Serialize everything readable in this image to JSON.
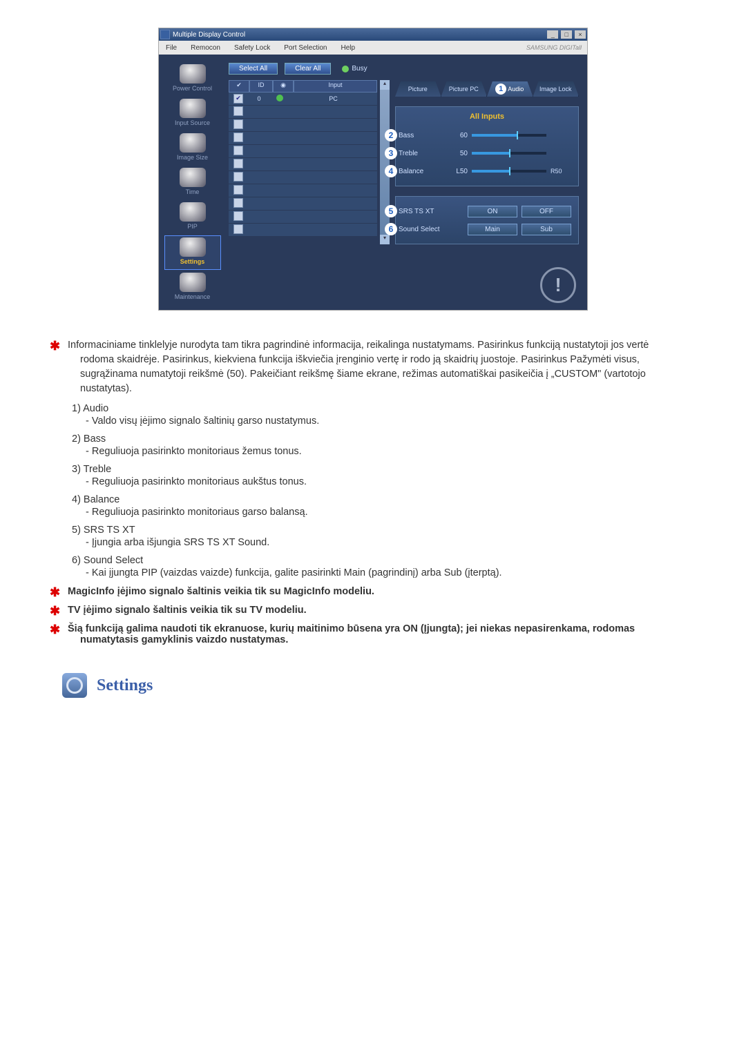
{
  "window": {
    "title": "Multiple Display Control",
    "win_buttons": {
      "min": "_",
      "max": "□",
      "close": "×"
    }
  },
  "menubar": {
    "items": [
      "File",
      "Remocon",
      "Safety Lock",
      "Port Selection",
      "Help"
    ],
    "brand": "SAMSUNG DIGITall"
  },
  "sidebar": {
    "items": [
      {
        "label": "Power Control"
      },
      {
        "label": "Input Source"
      },
      {
        "label": "Image Size"
      },
      {
        "label": "Time"
      },
      {
        "label": "PIP"
      },
      {
        "label": "Settings",
        "active": true
      },
      {
        "label": "Maintenance"
      }
    ]
  },
  "buttons": {
    "select_all": "Select All",
    "clear_all": "Clear All",
    "busy": "Busy"
  },
  "list": {
    "headers": {
      "check": "✔",
      "id": "ID",
      "status": "◉",
      "input": "Input"
    },
    "first_row": {
      "id": "0",
      "input": "PC",
      "checked": true,
      "online": true
    },
    "blank_rows": 10
  },
  "tabs": {
    "picture": "Picture",
    "picture_pc": "Picture PC",
    "audio": "Audio",
    "image_lock": "Image Lock",
    "badge_audio": "1"
  },
  "panel": {
    "all_inputs": "All Inputs",
    "rows": [
      {
        "num": "2",
        "label": "Bass",
        "val": "60",
        "pct": 60,
        "pre": "",
        "post": ""
      },
      {
        "num": "3",
        "label": "Treble",
        "val": "50",
        "pct": 50,
        "pre": "",
        "post": ""
      },
      {
        "num": "4",
        "label": "Balance",
        "val": "L50",
        "pct": 50,
        "pre": "",
        "post": "R50"
      }
    ],
    "srs": {
      "num": "5",
      "label": "SRS TS XT",
      "on": "ON",
      "off": "OFF"
    },
    "sound_select": {
      "num": "6",
      "label": "Sound Select",
      "main": "Main",
      "sub": "Sub"
    }
  },
  "doc": {
    "intro": "Informaciniame tinklelyje nurodyta tam tikra pagrindinė informacija, reikalinga nustatymams. Pasirinkus funkciją nustatytoji jos vertė rodoma skaidrėje. Pasirinkus, kiekviena funkcija iškviečia įrenginio vertę ir rodo ją skaidrių juostoje. Pasirinkus Pažymėti visus, sugrąžinama numatytoji reikšmė (50). Pakeičiant reikšmę šiame ekrane, režimas automatiškai pasikeičia į „CUSTOM\" (vartotojo nustatytas).",
    "items": [
      {
        "h": "1)  Audio",
        "d": "- Valdo visų įėjimo signalo šaltinių garso nustatymus."
      },
      {
        "h": "2)  Bass",
        "d": "- Reguliuoja pasirinkto monitoriaus žemus tonus."
      },
      {
        "h": "3)  Treble",
        "d": "- Reguliuoja pasirinkto monitoriaus aukštus tonus."
      },
      {
        "h": "4)  Balance",
        "d": "- Reguliuoja pasirinkto monitoriaus garso balansą."
      },
      {
        "h": "5)  SRS TS XT",
        "d": "- Įjungia arba išjungia SRS TS XT Sound."
      },
      {
        "h": "6)  Sound Select",
        "d": "- Kai įjungta PIP (vaizdas vaizde) funkcija, galite pasirinkti Main (pagrindinį) arba Sub (įterptą)."
      }
    ],
    "notes": [
      "MagicInfo įėjimo signalo šaltinis veikia tik su MagicInfo modeliu.",
      "TV įėjimo signalo šaltinis veikia tik su TV modeliu.",
      "Šią funkciją galima naudoti tik ekranuose, kurių maitinimo būsena yra ON (Įjungta); jei niekas nepasirenkama, rodomas numatytasis gamyklinis vaizdo nustatymas."
    ],
    "settings_heading": "Settings"
  }
}
